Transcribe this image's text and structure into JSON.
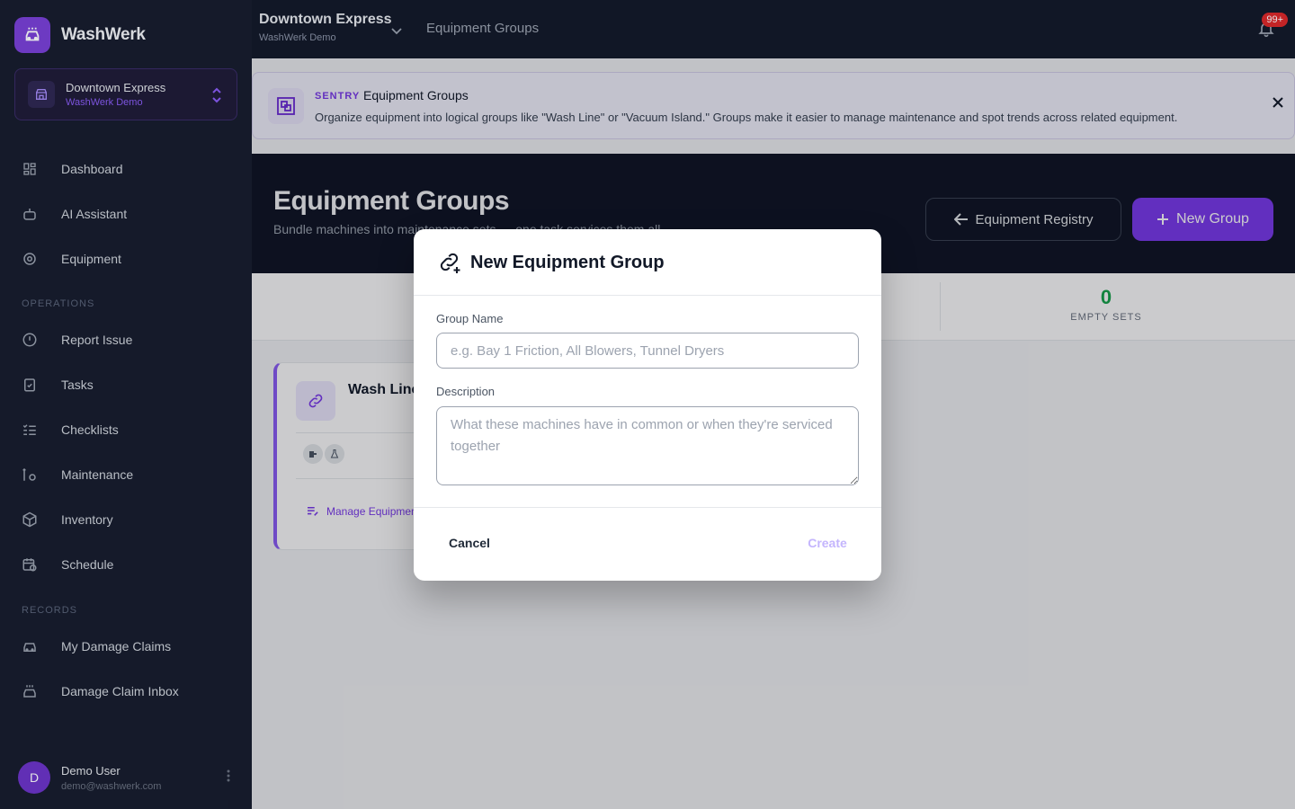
{
  "app": {
    "name": "WashWerk"
  },
  "site_switcher": {
    "name": "Downtown Express",
    "org": "WashWerk Demo"
  },
  "sidebar": {
    "items": [
      {
        "label": "Dashboard",
        "icon": "dashboard-icon"
      },
      {
        "label": "AI Assistant",
        "icon": "robot-icon"
      },
      {
        "label": "Equipment",
        "icon": "gear-icon"
      }
    ],
    "sections": [
      {
        "label": "OPERATIONS",
        "items": [
          {
            "label": "Report Issue",
            "icon": "alert-circle-icon"
          },
          {
            "label": "Tasks",
            "icon": "clipboard-check-icon"
          },
          {
            "label": "Checklists",
            "icon": "checklist-icon"
          },
          {
            "label": "Maintenance",
            "icon": "wrench-gear-icon"
          },
          {
            "label": "Inventory",
            "icon": "box-icon"
          },
          {
            "label": "Schedule",
            "icon": "calendar-clock-icon"
          }
        ]
      },
      {
        "label": "RECORDS",
        "items": [
          {
            "label": "My Damage Claims",
            "icon": "car-claim-icon"
          },
          {
            "label": "Damage Claim Inbox",
            "icon": "car-wash-icon"
          }
        ]
      }
    ]
  },
  "user": {
    "initial": "D",
    "name": "Demo User",
    "email": "demo@washwerk.com"
  },
  "header": {
    "site": "Downtown Express",
    "org": "WashWerk Demo",
    "page": "Equipment Groups",
    "notifications": "99+"
  },
  "banner": {
    "tag": "SENTRY",
    "title": "Equipment Groups",
    "text": "Organize equipment into logical groups like \"Wash Line\" or \"Vacuum Island.\" Groups make it easier to manage maintenance and spot trends across related equipment."
  },
  "hero": {
    "title": "Equipment Groups",
    "subtitle": "Bundle machines into maintenance sets — one task services them all.",
    "registry_button": "Equipment Registry",
    "new_button": "New Group"
  },
  "stats": {
    "empty_sets_value": "0",
    "empty_sets_label": "EMPTY SETS"
  },
  "group_card": {
    "title": "Wash Line",
    "manage_link": "Manage Equipment"
  },
  "modal": {
    "title": "New Equipment Group",
    "name_label": "Group Name",
    "name_placeholder": "e.g. Bay 1 Friction, All Blowers, Tunnel Dryers",
    "name_value": "",
    "desc_label": "Description",
    "desc_placeholder": "What these machines have in common or when they're serviced together",
    "desc_value": "",
    "cancel": "Cancel",
    "create": "Create"
  },
  "colors": {
    "accent": "#7c3aed",
    "sidebar": "#161b2b",
    "success": "#16a34a",
    "danger": "#dc2626"
  }
}
